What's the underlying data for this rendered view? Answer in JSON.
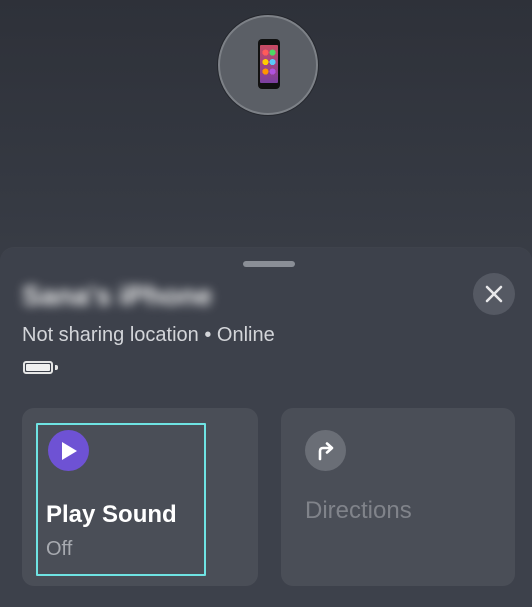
{
  "device": {
    "name": "Sana's iPhone",
    "status": "Not sharing location • Online",
    "battery_level": 1.0,
    "marker_icon": "iphone-icon"
  },
  "sheet": {
    "close_icon": "close-icon"
  },
  "actions": {
    "play_sound": {
      "label": "Play Sound",
      "status": "Off",
      "icon": "play-icon",
      "accent": "#6e52d4"
    },
    "directions": {
      "label": "Directions",
      "icon": "turn-right-arrow-icon"
    }
  },
  "colors": {
    "focus_ring": "#6fe3e3",
    "sheet_bg": "#3d414b",
    "card_bg": "#4a4e57"
  }
}
